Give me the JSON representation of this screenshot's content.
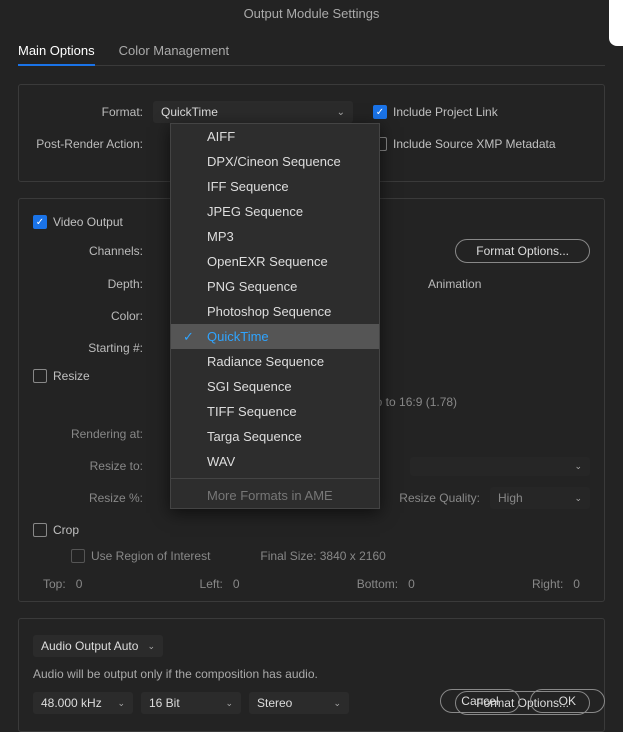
{
  "title": "Output Module Settings",
  "tabs": {
    "main": "Main Options",
    "color": "Color Management"
  },
  "topPanel": {
    "formatLabel": "Format:",
    "formatValue": "QuickTime",
    "postRenderLabel": "Post-Render Action:",
    "includeProjectLink": "Include Project Link",
    "includeXmp": "Include Source XMP Metadata"
  },
  "formatMenu": {
    "items": [
      "AIFF",
      "DPX/Cineon Sequence",
      "IFF Sequence",
      "JPEG Sequence",
      "MP3",
      "OpenEXR Sequence",
      "PNG Sequence",
      "Photoshop Sequence",
      "QuickTime",
      "Radiance Sequence",
      "SGI Sequence",
      "TIFF Sequence",
      "Targa Sequence",
      "WAV"
    ],
    "more": "More Formats in AME",
    "selected": "QuickTime"
  },
  "video": {
    "videoOutput": "Video Output",
    "channels": "Channels:",
    "depth": "Depth:",
    "color": "Color:",
    "starting": "Starting #:",
    "formatOptions": "Format Options...",
    "codec": "Animation",
    "resize": "Resize",
    "lockAspect": "io to 16:9 (1.78)",
    "renderingAt": "Rendering at:",
    "resizeTo": "Resize to:",
    "resizePct": "Resize %:",
    "resizeQuality": "Resize Quality:",
    "resizeQualityVal": "High",
    "crop": "Crop",
    "useRoi": "Use Region of Interest",
    "finalSize": "Final Size: 3840 x 2160",
    "top": "Top:",
    "topVal": "0",
    "left": "Left:",
    "leftVal": "0",
    "bottom": "Bottom:",
    "bottomVal": "0",
    "right": "Right:",
    "rightVal": "0"
  },
  "audio": {
    "outputSetting": "Audio Output Auto",
    "note": "Audio will be output only if the composition has audio.",
    "rate": "48.000 kHz",
    "depth": "16 Bit",
    "channels": "Stereo",
    "formatOptions": "Format Options..."
  },
  "buttons": {
    "cancel": "Cancel",
    "ok": "OK"
  }
}
